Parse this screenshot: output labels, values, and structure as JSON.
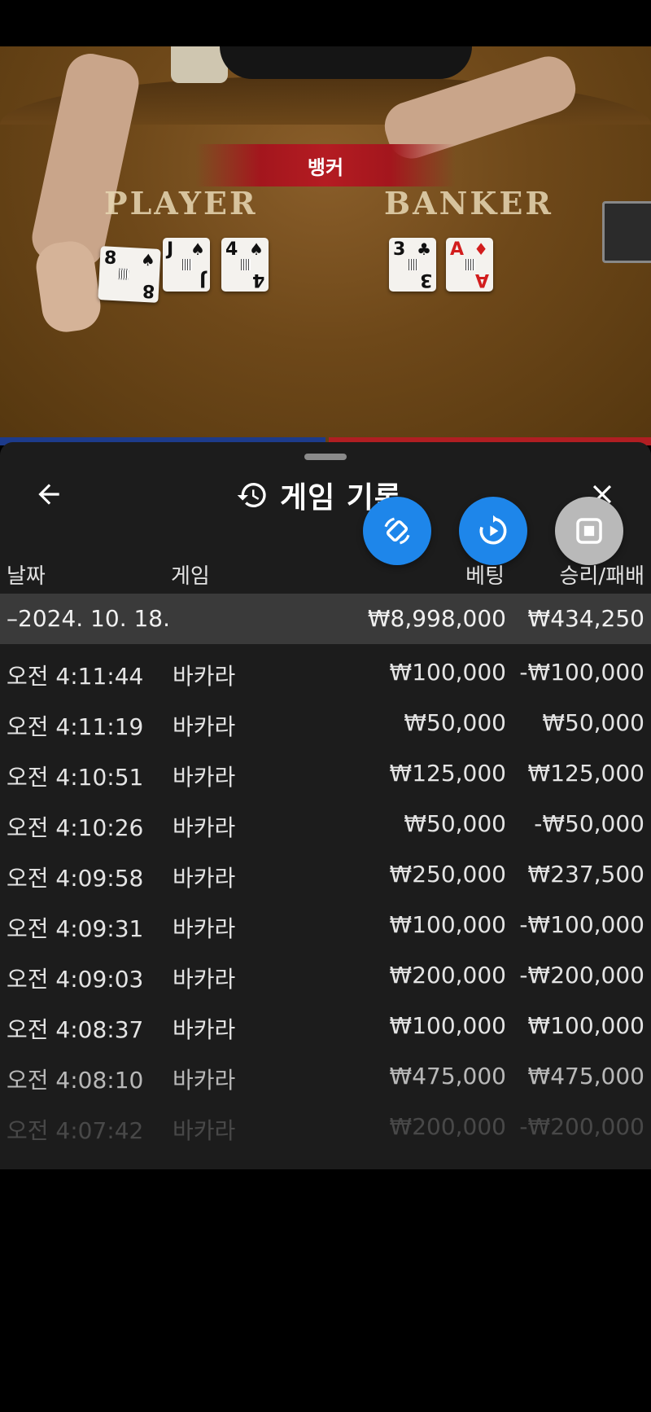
{
  "video": {
    "banner": "뱅커",
    "player_label": "PLAYER",
    "banker_label": "BANKER",
    "player_cards": [
      {
        "rank": "8",
        "suit": "♠"
      },
      {
        "rank": "J",
        "suit": "♠"
      },
      {
        "rank": "4",
        "suit": "♠"
      }
    ],
    "banker_cards": [
      {
        "rank": "3",
        "suit": "♣"
      },
      {
        "rank": "A",
        "suit": "♦"
      }
    ]
  },
  "sheet": {
    "title": "게임 기록",
    "icons": {
      "back": "arrow-left-icon",
      "history": "history-icon",
      "close": "close-icon"
    },
    "fabs": [
      {
        "icon": "rotate-screen-icon",
        "color": "#1e86ea"
      },
      {
        "icon": "replay-icon",
        "color": "#1e86ea"
      },
      {
        "icon": "stop-icon",
        "color": "#b9b9b9"
      }
    ],
    "columns": {
      "date": "날짜",
      "game": "게임",
      "bet": "베팅",
      "result": "승리/패배"
    },
    "summary": {
      "date": "–2024. 10. 18.",
      "bet": "₩8,998,000",
      "result": "₩434,250"
    },
    "rows": [
      {
        "time": "오전 4:11:44",
        "game": "바카라",
        "bet": "₩100,000",
        "result": "-₩100,000"
      },
      {
        "time": "오전 4:11:19",
        "game": "바카라",
        "bet": "₩50,000",
        "result": "₩50,000"
      },
      {
        "time": "오전 4:10:51",
        "game": "바카라",
        "bet": "₩125,000",
        "result": "₩125,000"
      },
      {
        "time": "오전 4:10:26",
        "game": "바카라",
        "bet": "₩50,000",
        "result": "-₩50,000"
      },
      {
        "time": "오전 4:09:58",
        "game": "바카라",
        "bet": "₩250,000",
        "result": "₩237,500"
      },
      {
        "time": "오전 4:09:31",
        "game": "바카라",
        "bet": "₩100,000",
        "result": "-₩100,000"
      },
      {
        "time": "오전 4:09:03",
        "game": "바카라",
        "bet": "₩200,000",
        "result": "-₩200,000"
      },
      {
        "time": "오전 4:08:37",
        "game": "바카라",
        "bet": "₩100,000",
        "result": "₩100,000"
      },
      {
        "time": "오전 4:08:10",
        "game": "바카라",
        "bet": "₩475,000",
        "result": "₩475,000"
      },
      {
        "time": "오전 4:07:42",
        "game": "바카라",
        "bet": "₩200,000",
        "result": "-₩200,000"
      }
    ]
  }
}
